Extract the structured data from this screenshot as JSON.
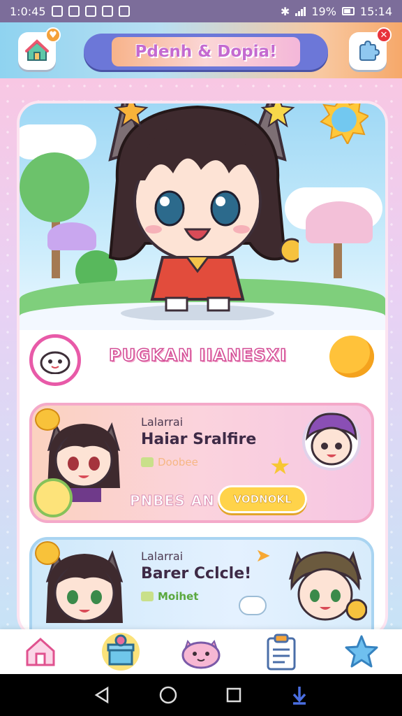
{
  "status_bar": {
    "time": "1:0:45",
    "battery": "19%",
    "clock": "15:14"
  },
  "header": {
    "title": "Pdenh & Dopia!",
    "notification_count": "✕"
  },
  "hero": {
    "character": "chibi-girl-cat-ears"
  },
  "section": {
    "title": "PUGKAN IIANESXI"
  },
  "cards": [
    {
      "kicker": "Lalarrai",
      "title": "Haiar Sralfire",
      "meta": "Doobee",
      "footer_label": "PNBES AN",
      "button_label": "VODNOKL"
    },
    {
      "kicker": "Lalarrai",
      "title": "Barer Cclcle!",
      "meta": "Moihet"
    }
  ],
  "tabs": [
    "home-icon",
    "gift-icon",
    "pet-icon",
    "clipboard-icon",
    "star-icon"
  ],
  "colors": {
    "accent_pink": "#e85aa8",
    "accent_blue": "#6c77d8",
    "button_yellow": "#ffd34a"
  }
}
